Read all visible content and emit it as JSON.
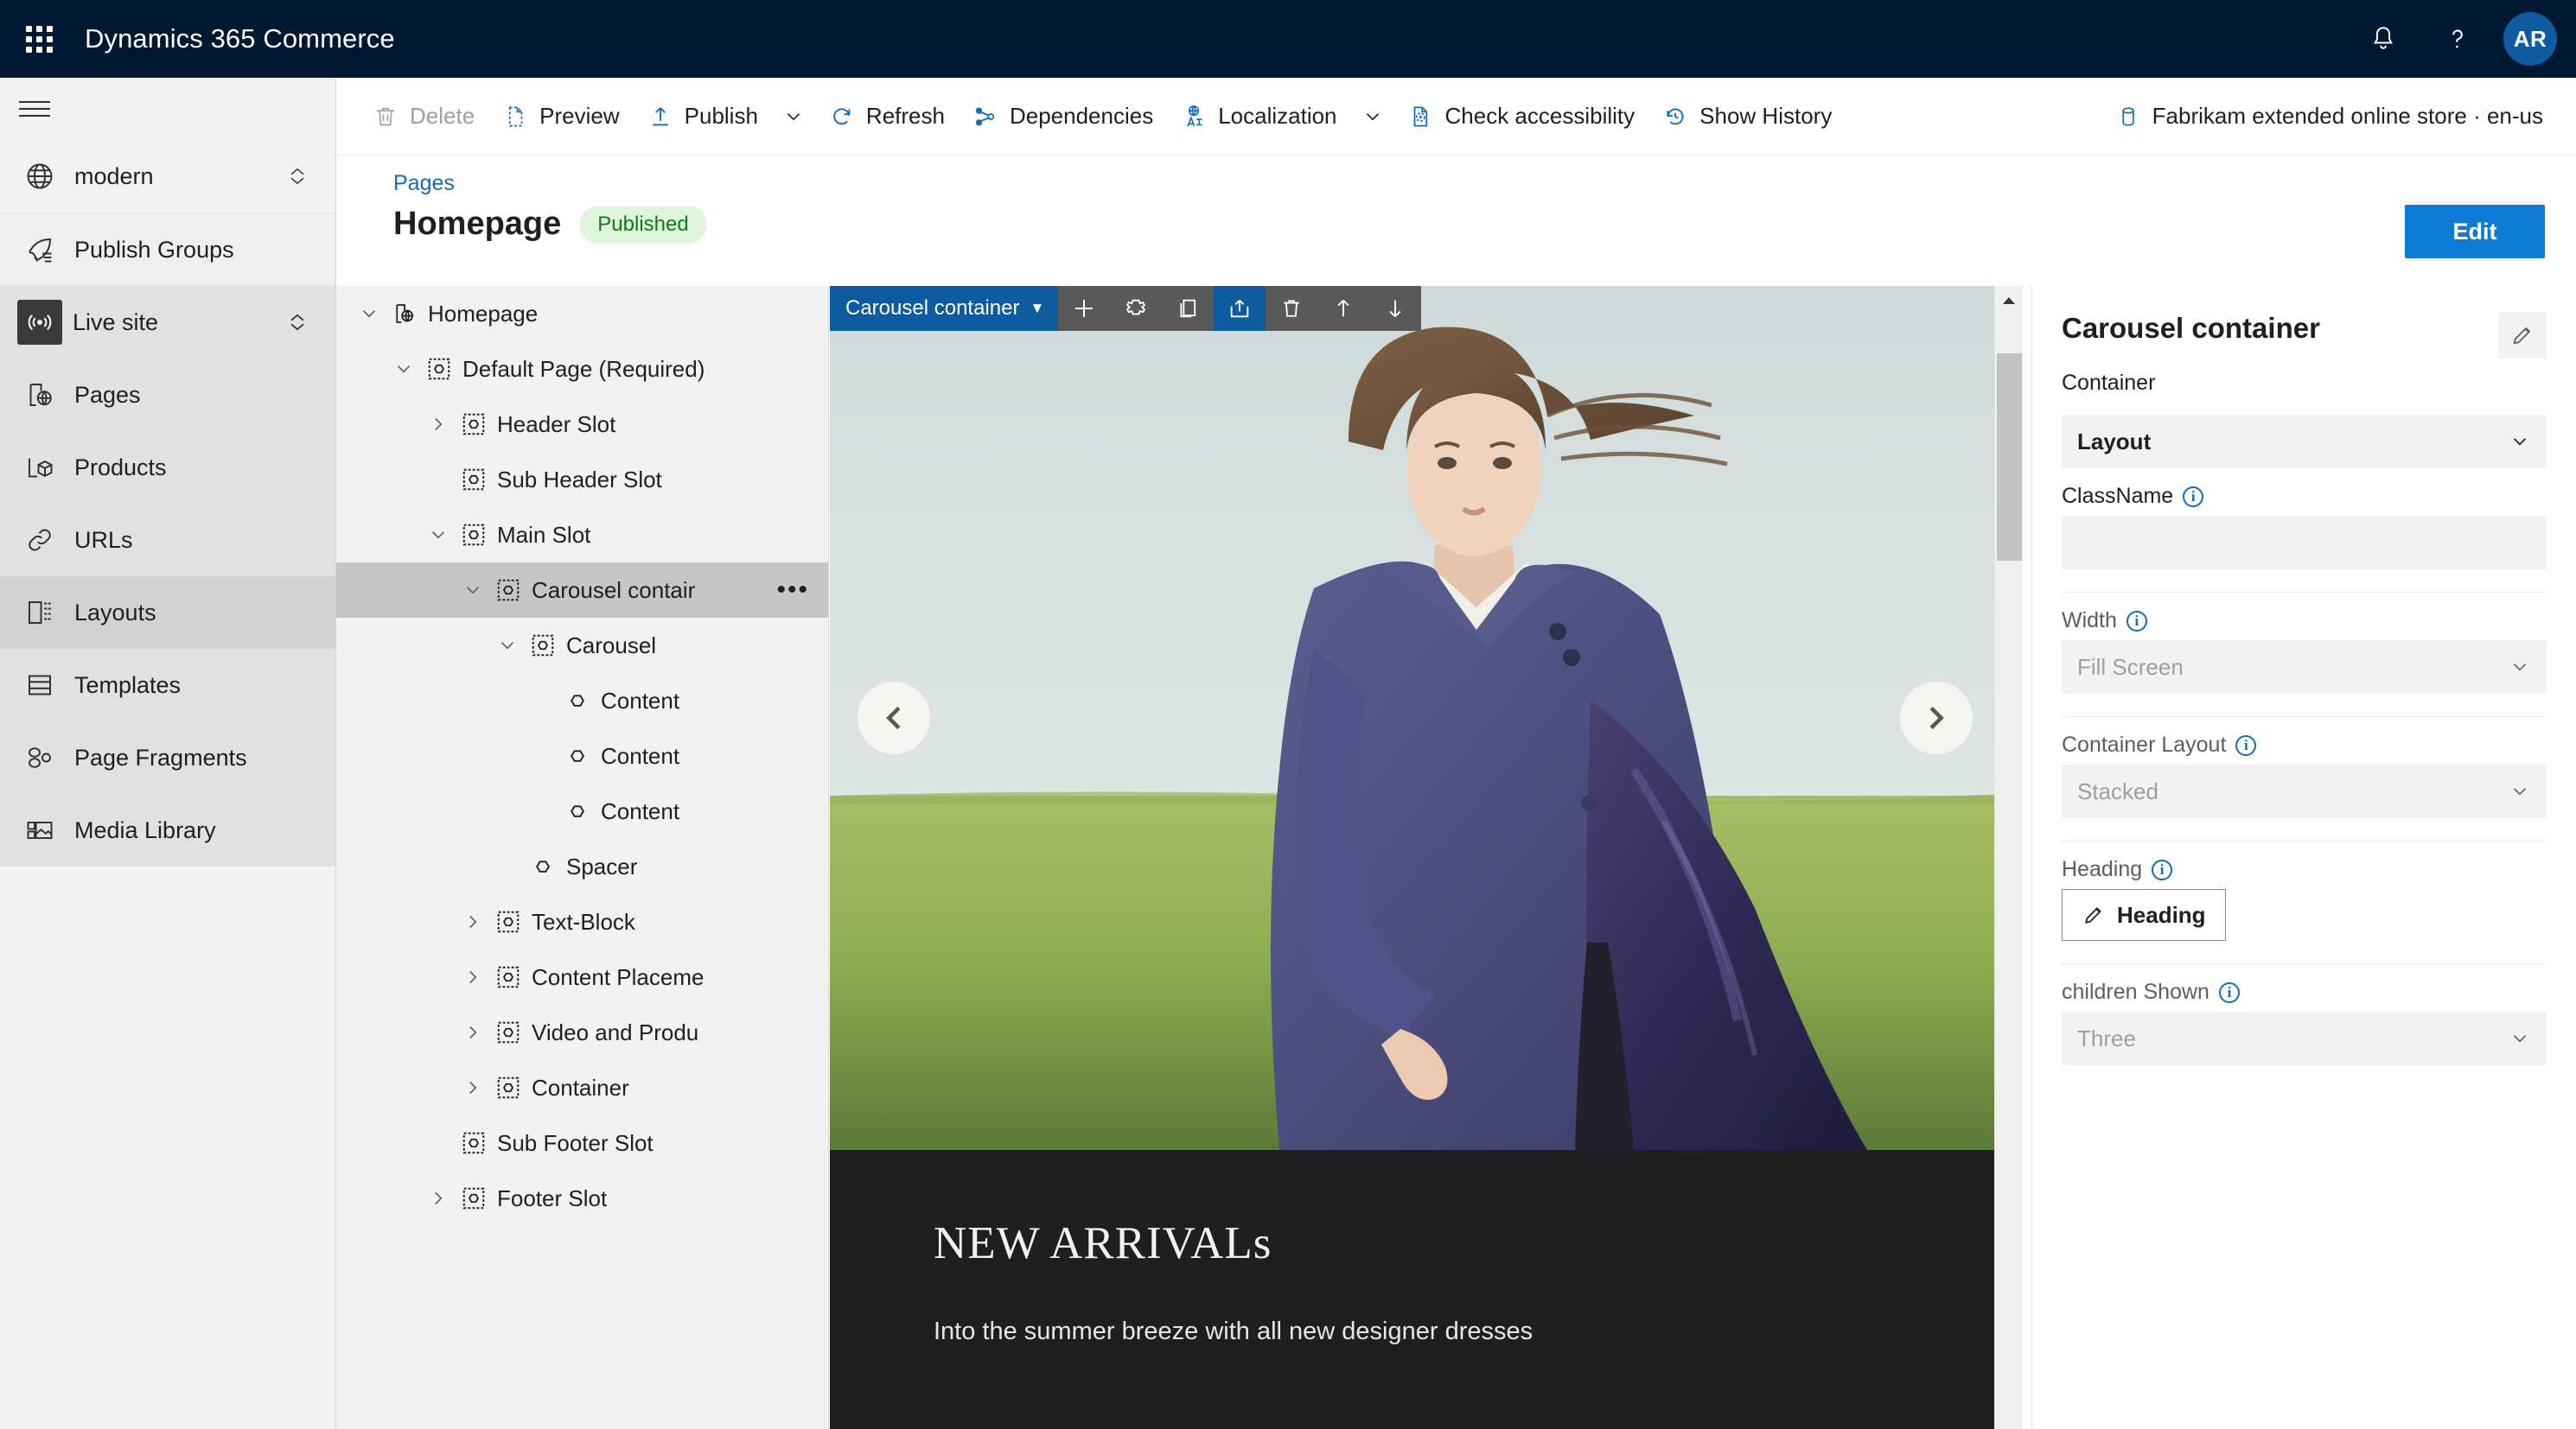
{
  "appbar": {
    "waffle_icon": "waffle-grid-icon",
    "title": "Dynamics 365 Commerce",
    "notifications_icon": "bell-icon",
    "help_icon": "question-mark-icon",
    "avatar_initials": "AR"
  },
  "leftnav": {
    "hamburger_icon": "hamburger-menu-icon",
    "site": {
      "label": "modern",
      "icon": "globe-icon",
      "chevron": "expand-collapse-icon"
    },
    "items": [
      {
        "label": "Publish Groups",
        "icon": "rocket-icon",
        "state": "light"
      },
      {
        "label": "Live site",
        "icon": "broadcast-icon",
        "state": "mid",
        "boxed": true,
        "chevron": "expand-collapse-icon"
      },
      {
        "label": "Pages",
        "icon": "page-globe-icon",
        "state": "mid"
      },
      {
        "label": "Products",
        "icon": "product-box-icon",
        "state": "mid"
      },
      {
        "label": "URLs",
        "icon": "link-icon",
        "state": "mid"
      },
      {
        "label": "Layouts",
        "icon": "layout-icon",
        "state": "dark"
      },
      {
        "label": "Templates",
        "icon": "template-icon",
        "state": "mid"
      },
      {
        "label": "Page Fragments",
        "icon": "fragments-icon",
        "state": "mid"
      },
      {
        "label": "Media Library",
        "icon": "media-image-icon",
        "state": "mid"
      }
    ]
  },
  "commandbar": {
    "items": [
      {
        "label": "Delete",
        "icon": "trash-icon",
        "disabled": true
      },
      {
        "label": "Preview",
        "icon": "preview-page-icon",
        "disabled": false
      },
      {
        "label": "Publish",
        "icon": "publish-upload-icon",
        "disabled": false,
        "caret": true
      },
      {
        "label": "Refresh",
        "icon": "refresh-icon",
        "disabled": false
      },
      {
        "label": "Dependencies",
        "icon": "dependencies-icon",
        "disabled": false
      },
      {
        "label": "Localization",
        "icon": "localization-globe-icon",
        "disabled": false,
        "caret": true
      },
      {
        "label": "Check accessibility",
        "icon": "accessibility-check-icon",
        "disabled": false
      },
      {
        "label": "Show History",
        "icon": "history-clock-icon",
        "disabled": false
      }
    ],
    "store": {
      "label": "Fabrikam extended online store · en-us",
      "icon": "database-icon"
    }
  },
  "pageheader": {
    "breadcrumb": "Pages",
    "title": "Homepage",
    "status": "Published",
    "edit_button": "Edit"
  },
  "tree": {
    "nodes": [
      {
        "label": "Homepage",
        "indent": 0,
        "chevron": "down",
        "icon": "page-globe-icon",
        "selected": false,
        "dots": false
      },
      {
        "label": "Default Page (Required)",
        "indent": 1,
        "chevron": "down",
        "icon": "module-slot-icon",
        "selected": false,
        "dots": false
      },
      {
        "label": "Header Slot",
        "indent": 2,
        "chevron": "right",
        "icon": "module-slot-icon",
        "selected": false,
        "dots": false
      },
      {
        "label": "Sub Header Slot",
        "indent": 2,
        "chevron": "none",
        "icon": "module-slot-icon",
        "selected": false,
        "dots": false
      },
      {
        "label": "Main Slot",
        "indent": 2,
        "chevron": "down",
        "icon": "module-slot-icon",
        "selected": false,
        "dots": false
      },
      {
        "label": "Carousel contair",
        "indent": 3,
        "chevron": "down",
        "icon": "module-slot-icon",
        "selected": true,
        "dots": true
      },
      {
        "label": "Carousel",
        "indent": 4,
        "chevron": "down",
        "icon": "module-slot-icon",
        "selected": false,
        "dots": false
      },
      {
        "label": "Content",
        "indent": 5,
        "chevron": "none",
        "icon": "module-hex-icon",
        "selected": false,
        "dots": false
      },
      {
        "label": "Content",
        "indent": 5,
        "chevron": "none",
        "icon": "module-hex-icon",
        "selected": false,
        "dots": false
      },
      {
        "label": "Content",
        "indent": 5,
        "chevron": "none",
        "icon": "module-hex-icon",
        "selected": false,
        "dots": false
      },
      {
        "label": "Spacer",
        "indent": 4,
        "chevron": "none",
        "icon": "module-hex-icon",
        "selected": false,
        "dots": false
      },
      {
        "label": "Text-Block",
        "indent": 3,
        "chevron": "right",
        "icon": "module-slot-icon",
        "selected": false,
        "dots": false
      },
      {
        "label": "Content Placeme",
        "indent": 3,
        "chevron": "right",
        "icon": "module-slot-icon",
        "selected": false,
        "dots": false
      },
      {
        "label": "Video and Produ",
        "indent": 3,
        "chevron": "right",
        "icon": "module-slot-icon",
        "selected": false,
        "dots": false
      },
      {
        "label": "Container",
        "indent": 3,
        "chevron": "right",
        "icon": "module-slot-icon",
        "selected": false,
        "dots": false
      },
      {
        "label": "Sub Footer Slot",
        "indent": 2,
        "chevron": "none",
        "icon": "module-slot-icon",
        "selected": false,
        "dots": false
      },
      {
        "label": "Footer Slot",
        "indent": 2,
        "chevron": "right",
        "icon": "module-slot-icon",
        "selected": false,
        "dots": false
      }
    ]
  },
  "canvas": {
    "module_toolbar": {
      "name": "Carousel container",
      "caret_icon": "chevron-down-icon",
      "buttons": [
        {
          "icon": "add-plus-icon",
          "accent": false
        },
        {
          "icon": "module-add-icon",
          "accent": false
        },
        {
          "icon": "copy-icon",
          "accent": false
        },
        {
          "icon": "share-icon",
          "accent": true
        },
        {
          "icon": "trash-icon",
          "accent": false
        },
        {
          "icon": "move-up-icon",
          "accent": false
        },
        {
          "icon": "move-down-icon",
          "accent": false
        }
      ]
    },
    "carousel": {
      "prev_icon": "chevron-left-icon",
      "next_icon": "chevron-right-icon",
      "heading": "NEW ARRIVALs",
      "subtext": "Into the summer breeze with all new designer dresses"
    },
    "scrollbar": {
      "up_icon": "scroll-up-arrow-icon"
    }
  },
  "properties": {
    "title": "Carousel container",
    "edit_icon": "pencil-edit-icon",
    "subtitle": "Container",
    "layout_select": {
      "value": "Layout",
      "chevron": "chevron-down-icon"
    },
    "classname": {
      "label": "ClassName",
      "value": "",
      "info_icon": "info-icon"
    },
    "width": {
      "label": "Width",
      "value": "Fill Screen",
      "info_icon": "info-icon",
      "chevron": "chevron-down-icon"
    },
    "container_layout": {
      "label": "Container Layout",
      "value": "Stacked",
      "info_icon": "info-icon",
      "chevron": "chevron-down-icon"
    },
    "heading": {
      "label": "Heading",
      "button_label": "Heading",
      "info_icon": "info-icon",
      "button_icon": "pencil-edit-icon"
    },
    "children_shown": {
      "label": "children Shown",
      "value": "Three",
      "info_icon": "info-icon",
      "chevron": "chevron-down-icon"
    }
  },
  "colors": {
    "appbar_bg": "#001832",
    "accent_blue": "#0f6cbd",
    "edit_button": "#0f7ad4",
    "module_toolbar_blue": "#0f5ba0",
    "module_toolbar_gray": "#595959",
    "published_bg": "#dff6dd",
    "published_text": "#107c10",
    "nav_bg": "#f2f2f1",
    "selected_row": "#c8c6c4"
  }
}
